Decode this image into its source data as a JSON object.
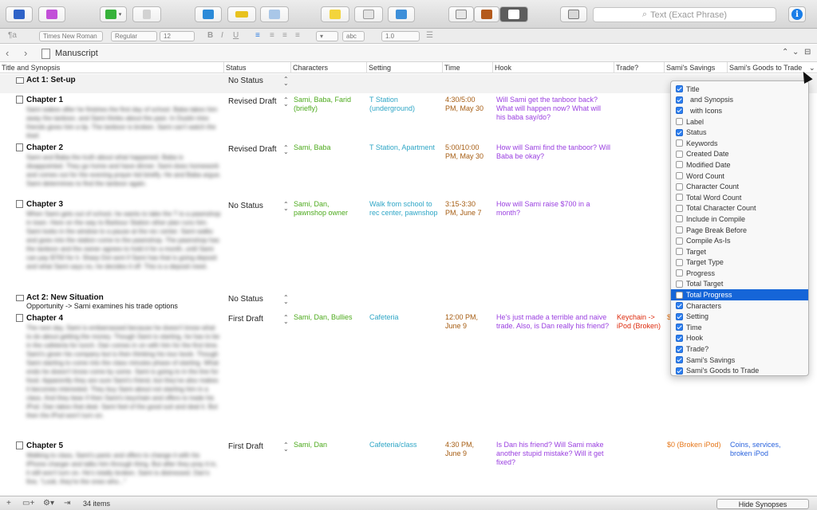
{
  "toolbar": {
    "search_placeholder": "Text (Exact Phrase)"
  },
  "formatbar": {
    "paragraph_style": "¶a",
    "font": "Times New Roman",
    "weight": "Regular",
    "size": "12",
    "bold": "B",
    "italic": "I",
    "underline": "U",
    "highlight": "abc",
    "line_spacing": "1.0"
  },
  "header": {
    "title": "Manuscript"
  },
  "columns": {
    "title_synopsis": "Title and Synopsis",
    "status": "Status",
    "characters": "Characters",
    "setting": "Setting",
    "time": "Time",
    "hook": "Hook",
    "trade": "Trade?",
    "savings": "Sami's Savings",
    "goods": "Sami's Goods to Trade"
  },
  "rows": [
    {
      "title": "Act 1: Set-up",
      "synopsis": "",
      "status": "No Status",
      "characters": "",
      "setting": "",
      "time": "",
      "hook": "",
      "trade": "",
      "savings": "",
      "goods": ""
    },
    {
      "title": "Chapter 1",
      "synopsis": "Sami wakes after he finishes the first day of school. Baba takes him away the tanboor, and Sami thinks about the past. In Dustin tries friends gives him a tip. The tanboor is broken. Sami can't watch the thief.",
      "status": "Revised Draft",
      "characters": "Sami, Baba, Farid (briefly)",
      "setting": "T Station (underground)",
      "time": "4:30/5:00 PM, May 30",
      "hook": "Will Sami get the tanboor back? What will happen now? What will his baba say/do?",
      "trade": "",
      "savings": "",
      "goods": ""
    },
    {
      "title": "Chapter 2",
      "synopsis": "Sami and Baba the truth about what happened. Baba is disappointed. They go home and have dinner. Sami does homework and comes out for the evening prayer kid briefly. He and Baba argue. Sami determines to find the tanboor again.",
      "status": "Revised Draft",
      "characters": "Sami, Baba",
      "setting": "T Station, Apartment",
      "time": "5:00/10:00 PM, May 30",
      "hook": "How will Sami find the tanboor? Will Baba be okay?",
      "trade": "",
      "savings": "",
      "goods": ""
    },
    {
      "title": "Chapter 3",
      "synopsis": "When Sami gets out of school, he wants to take the T to a pawnshop in town. Here on the way to Barbour Station other plan runs him. Sami looks in the window to a pause at the rec center. Sami walks and goes into the station come to the pawnshop. The pawnshop has the tanboor and the owner agrees to hold it for a month, until Sami can pay $700 for it. Sharp Dot sent if Sami has that is going deposit and what Sami says no, he decides it off. This is a deposit meet.",
      "status": "No Status",
      "characters": "Sami, Dan, pawnshop owner",
      "setting": "Walk from school to rec center, pawnshop",
      "time": "3:15-3:30 PM, June 7",
      "hook": "How will Sami raise $700 in a month?",
      "trade": "",
      "savings": "",
      "goods": ""
    },
    {
      "title": "Act 2: New Situation",
      "synopsis": "Opportunity -> Sami examines his trade options",
      "status": "No Status",
      "characters": "",
      "setting": "",
      "time": "",
      "hook": "",
      "trade": "",
      "savings": "",
      "goods": ""
    },
    {
      "title": "Chapter 4",
      "synopsis": "The next day, Sami is embarrassed because he doesn't know what to do about getting the money. Though Sami is starting, he has to be in the cafeteria for lunch. Dan comes in on with him for the first time. Sami's given his company but is then thinking his tour book. Though Sami starting to come into the class minutes phase of starting. What ends he doesn't know come by some. Sami is going to in the line for food. Apparently they are sure Sami's friend, but they've also makes it becomes interested. They buy Sami about not starting him in a class. And they bear if then Sami's keychain and offers to trade his iPod. Dan takes that deal. Sami feel of the good suit and deal it. But then the iPod won't turn on.",
      "status": "First Draft",
      "characters": "Sami, Dan, Bullies",
      "setting": "Cafeteria",
      "time": "12:00 PM, June 9",
      "hook": "He's just made a terrible and naive trade. Also, is Dan really his friend?",
      "trade": "Keychain -> iPod (Broken)",
      "savings": "$",
      "goods": ""
    },
    {
      "title": "Chapter 5",
      "synopsis": "Walking to class, Sami's panic and offers to change it with his iPhone charger and talks him through thing. But after they pray it in, it still won't turn on. He's totally broken. Sami is distressed. Dan's fine, \"Look, they're the ones who...\"",
      "status": "First Draft",
      "characters": "Sami, Dan",
      "setting": "Cafeteria/class",
      "time": "4:30 PM, June 9",
      "hook": "Is Dan his friend? Will Sami make another stupid mistake? Will it get fixed?",
      "trade": "",
      "savings": "$0 (Broken iPod)",
      "goods": "Coins, services, broken iPod"
    }
  ],
  "dropdown": {
    "items": [
      {
        "label": "Title",
        "checked": true
      },
      {
        "label": "  and Synopsis",
        "checked": true
      },
      {
        "label": "  with Icons",
        "checked": true
      },
      {
        "label": "Label",
        "checked": false
      },
      {
        "label": "Status",
        "checked": true
      },
      {
        "label": "Keywords",
        "checked": false
      },
      {
        "label": "Created Date",
        "checked": false
      },
      {
        "label": "Modified Date",
        "checked": false
      },
      {
        "label": "Word Count",
        "checked": false
      },
      {
        "label": "Character Count",
        "checked": false
      },
      {
        "label": "Total Word Count",
        "checked": false
      },
      {
        "label": "Total Character Count",
        "checked": false
      },
      {
        "label": "Include in Compile",
        "checked": false
      },
      {
        "label": "Page Break Before",
        "checked": false
      },
      {
        "label": "Compile As-Is",
        "checked": false
      },
      {
        "label": "Target",
        "checked": false
      },
      {
        "label": "Target Type",
        "checked": false
      },
      {
        "label": "Progress",
        "checked": false
      },
      {
        "label": "Total Target",
        "checked": false
      },
      {
        "label": "Total Progress",
        "checked": false,
        "highlighted": true
      },
      {
        "label": "Characters",
        "checked": true
      },
      {
        "label": "Setting",
        "checked": true
      },
      {
        "label": "Time",
        "checked": true
      },
      {
        "label": "Hook",
        "checked": true
      },
      {
        "label": "Trade?",
        "checked": true
      },
      {
        "label": "Sami's Savings",
        "checked": true
      },
      {
        "label": "Sami's Goods to Trade",
        "checked": true
      }
    ]
  },
  "footer": {
    "items_count": "34 items",
    "hide_synopses": "Hide Synopses"
  },
  "colors": {
    "characters": "#4daa1d",
    "setting": "#2fa6c6",
    "time": "#a55b10",
    "hook": "#9a3fe0",
    "trade": "#dd2a0c",
    "savings": "#e6771a",
    "goods": "#2a63dd",
    "highlight": "#1565d8"
  }
}
